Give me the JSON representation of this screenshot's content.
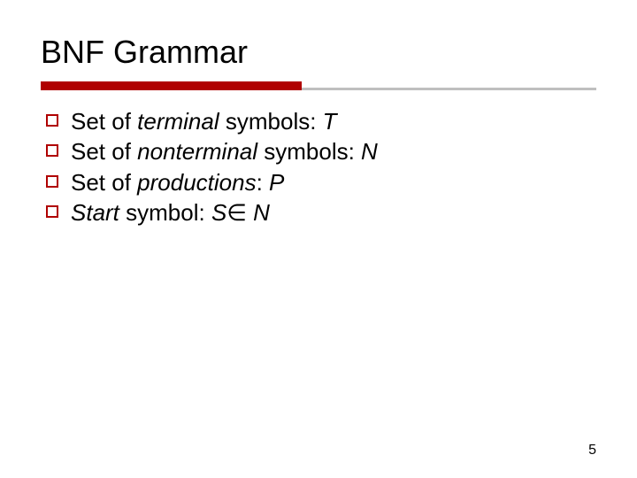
{
  "slide": {
    "title": "BNF Grammar",
    "bullets": [
      {
        "pre": "Set of ",
        "ital": "terminal",
        "mid": " symbols: ",
        "sym": "T",
        "post": ""
      },
      {
        "pre": "Set of ",
        "ital": "nonterminal",
        "mid": " symbols: ",
        "sym": "N",
        "post": ""
      },
      {
        "pre": "Set of ",
        "ital": "productions",
        "mid": ": ",
        "sym": "P",
        "post": ""
      },
      {
        "pre": "",
        "ital": "Start",
        "mid": " symbol:  ",
        "sym": "S",
        "post": "∈ N",
        "post_sym": "N"
      }
    ],
    "page_number": "5"
  }
}
